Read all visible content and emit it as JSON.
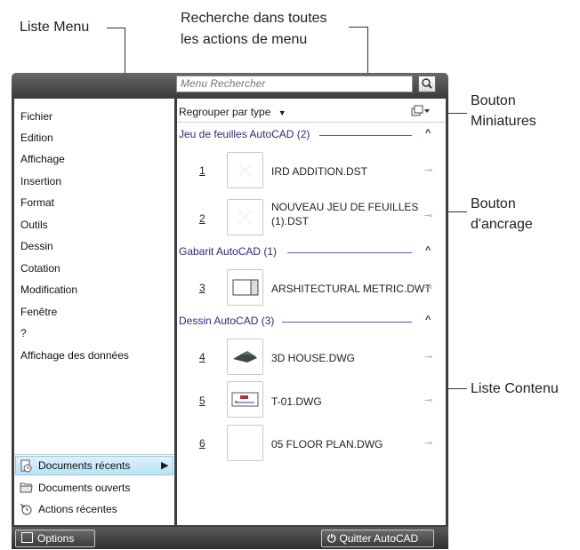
{
  "callouts": {
    "liste_menu": "Liste Menu",
    "recherche_l1": "Recherche dans toutes",
    "recherche_l2": "les actions de menu",
    "miniatures_l1": "Bouton",
    "miniatures_l2": "Miniatures",
    "ancrage_l1": "Bouton",
    "ancrage_l2": "d'ancrage",
    "liste_contenu": "Liste Contenu"
  },
  "search": {
    "placeholder": "Menu Rechercher"
  },
  "menu_items": [
    "Fichier",
    "Edition",
    "Affichage",
    "Insertion",
    "Format",
    "Outils",
    "Dessin",
    "Cotation",
    "Modification",
    "Fenêtre",
    "?",
    "Affichage des données"
  ],
  "bottom_items": {
    "recent_docs": "Documents récents",
    "open_docs": "Documents ouverts",
    "recent_actions": "Actions récentes"
  },
  "group_by": "Regrouper par type",
  "groups": [
    {
      "title": "Jeu de feuilles AutoCAD (2)"
    },
    {
      "title": "Gabarit AutoCAD (1)"
    },
    {
      "title": "Dessin AutoCAD (3)"
    }
  ],
  "files": [
    {
      "num": "1",
      "name": "IRD ADDITION.DST"
    },
    {
      "num": "2",
      "name_l1": "NOUVEAU JEU DE FEUILLES",
      "name_l2": "(1).DST"
    },
    {
      "num": "3",
      "name": "ARSHITECTURAL METRIC.DWT"
    },
    {
      "num": "4",
      "name": "3D HOUSE.DWG"
    },
    {
      "num": "5",
      "name": "T-01.DWG"
    },
    {
      "num": "6",
      "name": "05 FLOOR PLAN.DWG"
    }
  ],
  "footer": {
    "options": "Options",
    "quit": "Quitter AutoCAD"
  },
  "colors": {
    "header_text": "#2a2a7a",
    "selection": "#b9e2f5",
    "chrome": "#3d3d3d"
  }
}
